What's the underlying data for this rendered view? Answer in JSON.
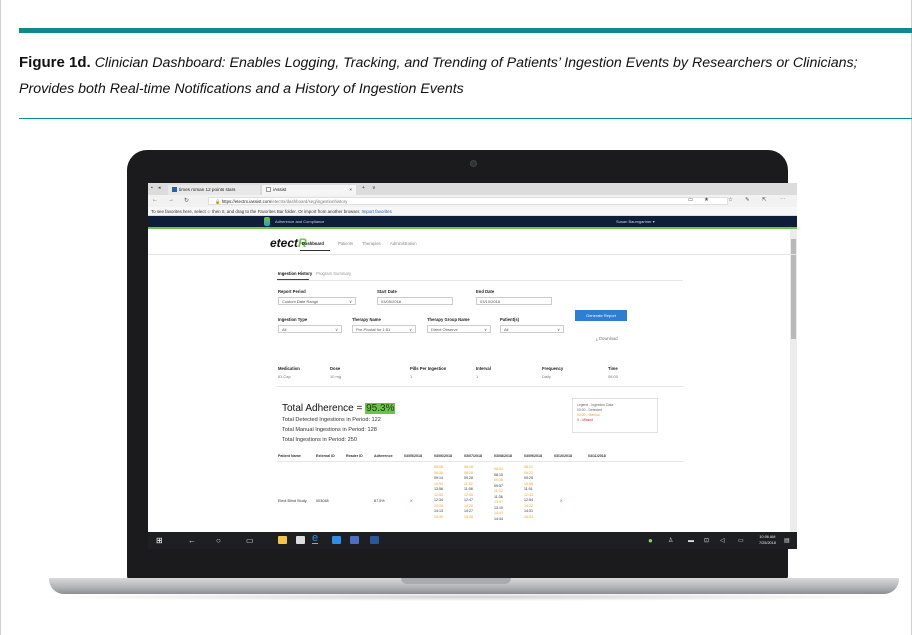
{
  "figure": {
    "label": "Figure 1d.",
    "caption_line1": "Clinician Dashboard: Enables Logging, Tracking, and Trending of Patients’ Ingestion Events by Researchers or Clinicians;",
    "caption_line2": "Provides both Real-time Notifications and a History of Ingestion Events"
  },
  "browser": {
    "tab1_label": "times roman 12 points stars",
    "tab2_label": "iAssist",
    "tab2_close": "×",
    "new_tab": "+",
    "tab_menu": "∨",
    "url_host": "https://etectrx.iassist.com",
    "url_path": "/etectrx/dashboard/seg/ingestionhistory",
    "favorites_text": "To see favorites here, select ☆ then ≡, and drag to the Favorites Bar folder. Or import from another browser.",
    "favorites_link": "Import favorites"
  },
  "app": {
    "header_title": "Adherence and Compliance",
    "user_name": "Susan Baumgartner ▾",
    "brand_main": "etect",
    "brand_suffix": "R",
    "nav": [
      "Dashboard",
      "Patients",
      "Therapies",
      "Administration"
    ],
    "subtabs": [
      "Ingestion History",
      "Program Summary"
    ]
  },
  "filters": {
    "report_period_label": "Report Period",
    "report_period_value": "Custom Date Range",
    "start_date_label": "Start Date",
    "start_date_value": "03/05/2018",
    "end_date_label": "End Date",
    "end_date_value": "03/10/2018",
    "generate_button": "Generate Report",
    "ingestion_type_label": "Ingestion Type",
    "ingestion_type_value": "All",
    "therapy_name_label": "Therapy Name",
    "therapy_name_value": "Pre-Pivotal for 1:51",
    "therapy_group_label": "Therapy Group Name",
    "therapy_group_value": "Direct Observe",
    "patients_label": "Patient(s)",
    "patients_value": "All",
    "download_label": "⤓  Download"
  },
  "medication": {
    "headers": [
      "Medication",
      "Dose",
      "Pills Per Ingestion",
      "Interval",
      "Frequency",
      "Time"
    ],
    "values": [
      "ID-Cap",
      "10 mg",
      "1",
      "1",
      "Daily",
      "08:00"
    ]
  },
  "adherence": {
    "title_prefix": "Total Adherence = ",
    "value": "95.3%",
    "detected": "Total Detected Ingestions in Period: 122",
    "manual": "Total Manual Ingestions in Period: 128",
    "total": "Total Ingestions in Period: 250"
  },
  "legend": {
    "title": "Legend - Ingestion Data",
    "detected": "00:00 - Detected",
    "manual": "00:00 - Manual",
    "missed": "X - Missed"
  },
  "table": {
    "headers": [
      "Patient Name",
      "External ID",
      "Reader ID",
      "Adherence",
      "03/05/2018",
      "03/06/2018",
      "03/07/2018",
      "03/08/2018",
      "03/09/2018",
      "03/10/2018",
      "03/11/2018"
    ],
    "row": {
      "patient_name": "Elect Blind Study",
      "external_id": "003048",
      "adherence": "87.5%",
      "missed_mark": "X",
      "missed_mark2": "X"
    },
    "times_0306": [
      [
        "08:08",
        "o"
      ],
      [
        "08:35",
        "o"
      ],
      [
        "09:14",
        "k"
      ],
      [
        "10:53",
        "o"
      ],
      [
        "13:56",
        "k"
      ],
      [
        "12:50",
        "o"
      ],
      [
        "12:34",
        "k"
      ],
      [
        "13:05",
        "o"
      ],
      [
        "14:13",
        "k"
      ],
      [
        "15:40",
        "o"
      ]
    ],
    "times_0307": [
      [
        "08:16",
        "o"
      ],
      [
        "08:28",
        "o"
      ],
      [
        "09:28",
        "k"
      ],
      [
        "11:02",
        "o"
      ],
      [
        "11:08",
        "k"
      ],
      [
        "12:40",
        "o"
      ],
      [
        "12:47",
        "k"
      ],
      [
        "14:20",
        "o"
      ],
      [
        "14:27",
        "k"
      ],
      [
        "15:28",
        "o"
      ]
    ],
    "times_0308": [
      [
        "08:04",
        "o"
      ],
      [
        "08:15",
        "k"
      ],
      [
        "09:36",
        "o"
      ],
      [
        "09:57",
        "k"
      ],
      [
        "11:32",
        "o"
      ],
      [
        "11:36",
        "k"
      ],
      [
        "13:07",
        "o"
      ],
      [
        "13:10",
        "k"
      ],
      [
        "14:41",
        "o"
      ],
      [
        "14:44",
        "k"
      ]
    ],
    "times_0309": [
      [
        "08:21",
        "o"
      ],
      [
        "09:22",
        "o"
      ],
      [
        "09:25",
        "k"
      ],
      [
        "10:55",
        "o"
      ],
      [
        "11:01",
        "k"
      ],
      [
        "12:43",
        "o"
      ],
      [
        "12:54",
        "k"
      ],
      [
        "14:22",
        "o"
      ],
      [
        "14:31",
        "k"
      ],
      [
        "16:03",
        "o"
      ]
    ]
  },
  "taskbar": {
    "time": "10:06 AM",
    "date": "7/25/2018"
  }
}
